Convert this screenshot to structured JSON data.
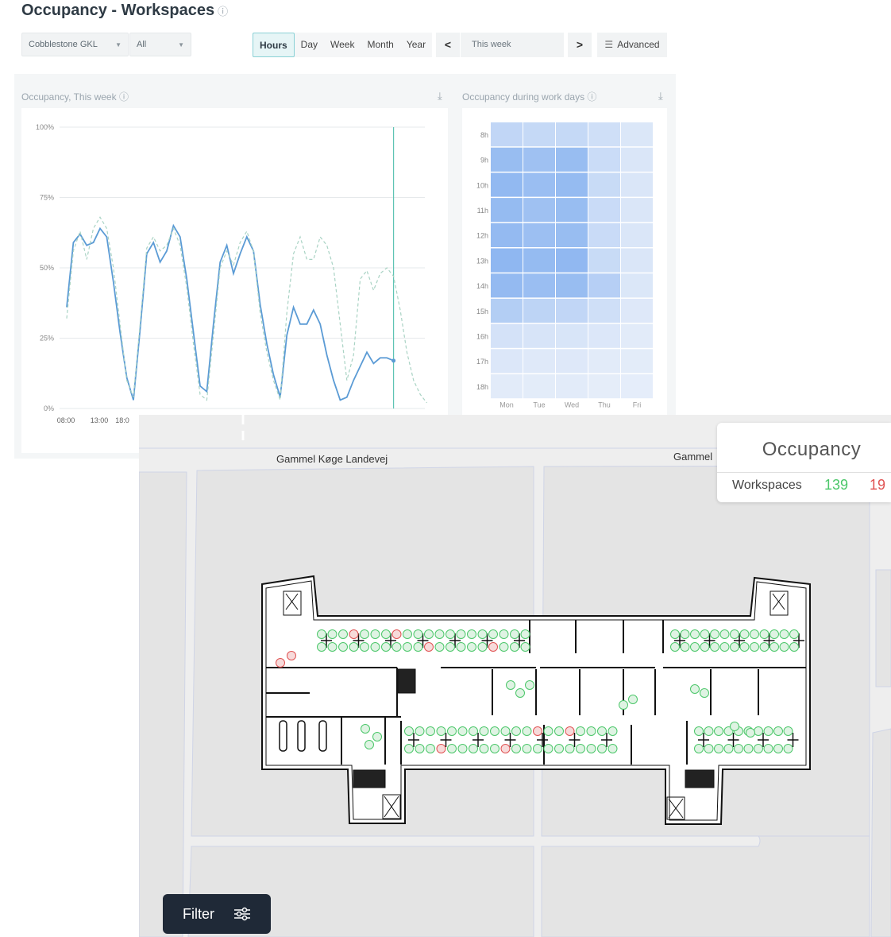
{
  "header": {
    "title": "Occupancy - Workspaces",
    "help_icon": "?"
  },
  "filters": {
    "building": "Cobblestone GKL",
    "floor": "All"
  },
  "range_tabs": [
    "Hours",
    "Day",
    "Week",
    "Month",
    "Year"
  ],
  "active_tab": "Hours",
  "period": {
    "prev": "<",
    "label": "This week",
    "next": ">"
  },
  "advanced_label": "Advanced",
  "line_panel": {
    "title": "Occupancy, This week",
    "help": "?"
  },
  "heatmap_panel": {
    "title": "Occupancy during work days",
    "help": "?"
  },
  "chart_data": [
    {
      "type": "line",
      "title": "Occupancy, This week",
      "ylim": [
        0,
        100
      ],
      "ytick_labels": [
        "100%",
        "75%",
        "50%",
        "25%",
        "0%"
      ],
      "xtick_labels": [
        "08:00",
        "13:00",
        "18:0"
      ],
      "series": [
        {
          "name": "current",
          "style": "solid",
          "color": "#5b9bd5",
          "values": [
            36,
            59,
            62,
            58,
            59,
            64,
            61,
            45,
            27,
            11,
            3,
            28,
            55,
            59,
            52,
            56,
            65,
            61,
            46,
            27,
            8,
            6,
            30,
            52,
            58,
            48,
            55,
            61,
            56,
            37,
            23,
            12,
            4,
            26,
            36,
            30,
            30,
            35,
            30,
            19,
            10,
            3,
            4,
            10,
            15,
            20,
            16,
            18,
            18,
            17
          ]
        },
        {
          "name": "previous",
          "style": "dashed",
          "color": "#a9d3c4",
          "values": [
            32,
            56,
            63,
            53,
            64,
            68,
            64,
            50,
            30,
            10,
            4,
            30,
            57,
            61,
            56,
            58,
            64,
            58,
            43,
            23,
            5,
            3,
            26,
            50,
            56,
            51,
            59,
            63,
            56,
            34,
            20,
            10,
            3,
            34,
            55,
            61,
            53,
            53,
            61,
            58,
            50,
            30,
            10,
            19,
            46,
            49,
            42,
            48,
            50,
            47,
            35,
            20,
            10,
            5,
            2
          ]
        }
      ],
      "cursor_index": 49
    },
    {
      "type": "heatmap",
      "title": "Occupancy during work days",
      "x": [
        "Mon",
        "Tue",
        "Wed",
        "Thu",
        "Fri"
      ],
      "y": [
        "8h",
        "9h",
        "10h",
        "11h",
        "12h",
        "13h",
        "14h",
        "15h",
        "16h",
        "17h",
        "18h"
      ],
      "values": [
        [
          30,
          27,
          27,
          20,
          11
        ],
        [
          60,
          55,
          60,
          23,
          12
        ],
        [
          64,
          58,
          62,
          25,
          12
        ],
        [
          62,
          55,
          60,
          24,
          12
        ],
        [
          63,
          57,
          60,
          24,
          12
        ],
        [
          66,
          62,
          65,
          25,
          12
        ],
        [
          63,
          58,
          60,
          38,
          11
        ],
        [
          40,
          33,
          30,
          20,
          9
        ],
        [
          16,
          14,
          13,
          10,
          6
        ],
        [
          10,
          8,
          9,
          6,
          5
        ],
        [
          6,
          5,
          6,
          4,
          3
        ]
      ]
    }
  ],
  "map": {
    "street_1": "Gammel Køge Landevej",
    "street_2": "Gammel",
    "occupancy_card": {
      "title": "Occupancy",
      "label": "Workspaces",
      "available": "139",
      "occupied": "19"
    },
    "filter_button": "Filter",
    "colors": {
      "available": "#4cc76a",
      "occupied": "#e05252"
    }
  }
}
